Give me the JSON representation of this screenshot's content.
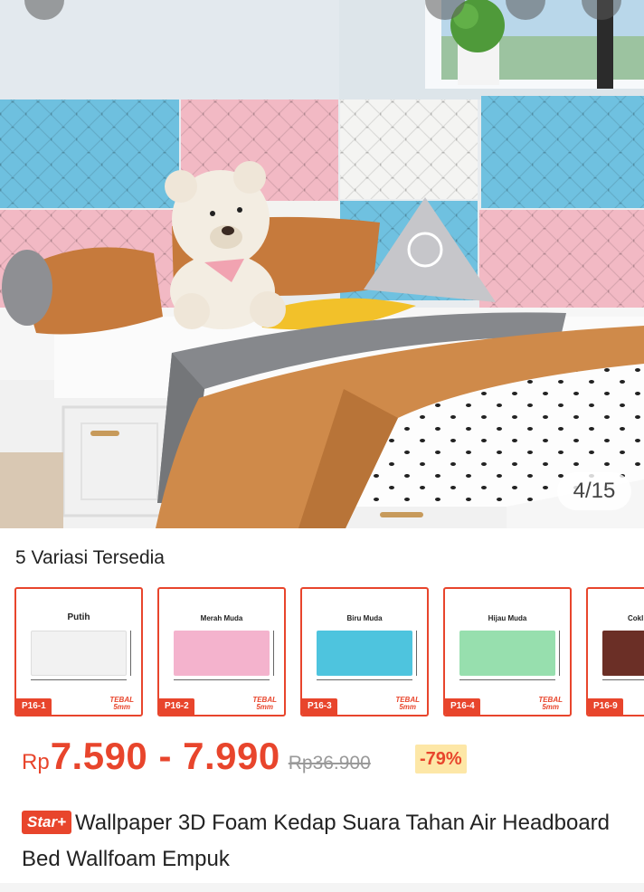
{
  "gallery": {
    "counter": "4/15"
  },
  "variations": {
    "title": "5 Variasi Tersedia",
    "items": [
      {
        "name": "Putih",
        "code": "P16-1",
        "color": "#f4f4f4",
        "thickness_line1": "TEBAL",
        "thickness_line2": "5mm"
      },
      {
        "name": "Merah Muda",
        "code": "P16-2",
        "color": "#f4b3cd",
        "thickness_line1": "TEBAL",
        "thickness_line2": "5mm"
      },
      {
        "name": "Biru Muda",
        "code": "P16-3",
        "color": "#4ec4de",
        "thickness_line1": "TEBAL",
        "thickness_line2": "5mm"
      },
      {
        "name": "Hijau Muda",
        "code": "P16-4",
        "color": "#97dfae",
        "thickness_line1": "TEBAL",
        "thickness_line2": "5mm"
      },
      {
        "name": "Cokl",
        "code": "P16-9",
        "color": "#6b2f26",
        "thickness_line1": "",
        "thickness_line2": ""
      }
    ]
  },
  "price": {
    "currency": "Rp",
    "range": "7.590 - 7.990",
    "original": "Rp36.900",
    "discount": "-79%"
  },
  "product": {
    "badge": "Star+",
    "title": "Wallpaper 3D Foam Kedap Suara Tahan Air Headboard Bed Wallfoam Empuk"
  },
  "colors": {
    "accent": "#e8452c",
    "discount_bg": "#fde7a7"
  }
}
